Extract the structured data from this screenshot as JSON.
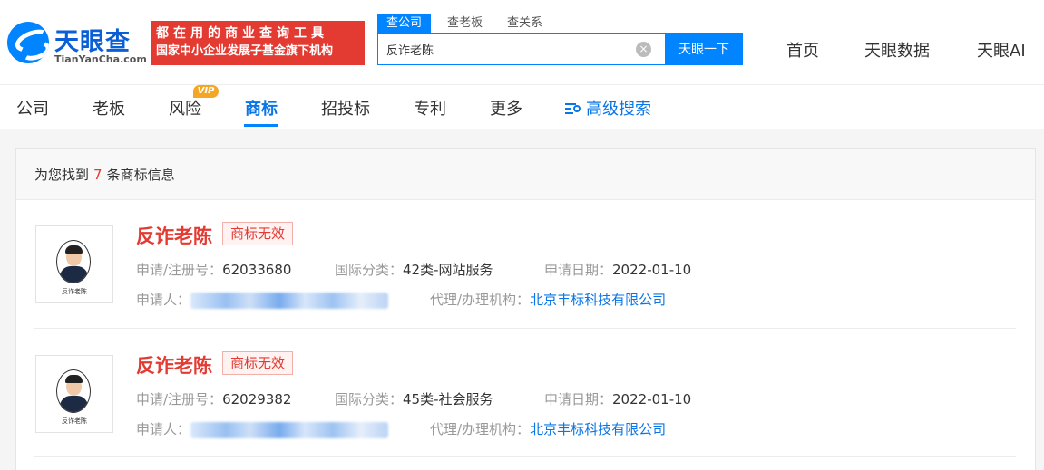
{
  "header": {
    "logo_cn": "天眼查",
    "logo_en": "TianYanCha.com",
    "slogan_line1": "都在用的商业查询工具",
    "slogan_line2": "国家中小企业发展子基金旗下机构",
    "search_tabs": [
      "查公司",
      "查老板",
      "查关系"
    ],
    "search_value": "反诈老陈",
    "search_button": "天眼一下",
    "nav": [
      "首页",
      "天眼数据",
      "天眼AI"
    ]
  },
  "subnav": {
    "items": [
      "公司",
      "老板",
      "风险",
      "商标",
      "招投标",
      "专利",
      "更多"
    ],
    "vip_label": "VIP",
    "active": "商标",
    "advanced_search": "高级搜索"
  },
  "results": {
    "count_prefix": "为您找到",
    "count": "7",
    "count_suffix": "条商标信息",
    "thumb_caption": "反诈老陈",
    "items": [
      {
        "name": "反诈老陈",
        "status": "商标无效",
        "reg_label": "申请/注册号：",
        "reg_no": "62033680",
        "class_label": "国际分类：",
        "class": "42类-网站服务",
        "date_label": "申请日期：",
        "date": "2022-01-10",
        "applicant_label": "申请人：",
        "agent_label": "代理/办理机构：",
        "agent": "北京丰标科技有限公司"
      },
      {
        "name": "反诈老陈",
        "status": "商标无效",
        "reg_label": "申请/注册号：",
        "reg_no": "62029382",
        "class_label": "国际分类：",
        "class": "45类-社会服务",
        "date_label": "申请日期：",
        "date": "2022-01-10",
        "applicant_label": "申请人：",
        "agent_label": "代理/办理机构：",
        "agent": "北京丰标科技有限公司"
      }
    ]
  },
  "colors": {
    "brand_blue": "#0084ff",
    "alert_red": "#e33a32",
    "link_blue": "#0a75e6"
  }
}
